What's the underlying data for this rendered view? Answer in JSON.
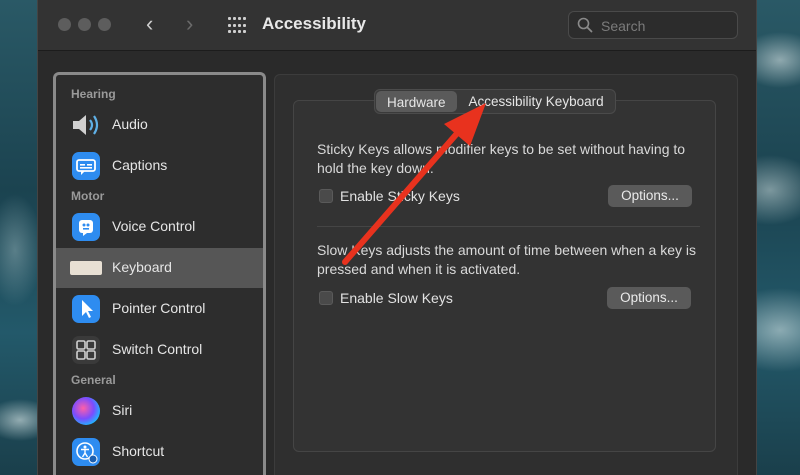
{
  "window": {
    "title": "Accessibility",
    "search_placeholder": "Search"
  },
  "sidebar": {
    "sections": [
      {
        "label": "Hearing"
      },
      {
        "label": "Motor"
      },
      {
        "label": "General"
      }
    ],
    "items": [
      {
        "label": "Audio",
        "icon": "speaker-icon"
      },
      {
        "label": "Captions",
        "icon": "captions-icon"
      },
      {
        "label": "Voice Control",
        "icon": "voice-control-icon"
      },
      {
        "label": "Keyboard",
        "icon": "keyboard-icon",
        "selected": true
      },
      {
        "label": "Pointer Control",
        "icon": "pointer-icon"
      },
      {
        "label": "Switch Control",
        "icon": "switch-control-icon"
      },
      {
        "label": "Siri",
        "icon": "siri-icon"
      },
      {
        "label": "Shortcut",
        "icon": "accessibility-shortcut-icon"
      }
    ]
  },
  "tabs": [
    {
      "label": "Hardware",
      "active": true
    },
    {
      "label": "Accessibility Keyboard",
      "active": false
    }
  ],
  "sticky": {
    "description": "Sticky Keys allows modifier keys to be set without having to hold the key down.",
    "checkbox_label": "Enable Sticky Keys",
    "checked": false,
    "options_label": "Options..."
  },
  "slow": {
    "description": "Slow Keys adjusts the amount of time between when a key is pressed and when it is activated.",
    "checkbox_label": "Enable Slow Keys",
    "checked": false,
    "options_label": "Options..."
  },
  "colors": {
    "window_bg": "#2a2a2a",
    "selected_row": "#565656",
    "annotation_arrow": "#e8321e"
  }
}
